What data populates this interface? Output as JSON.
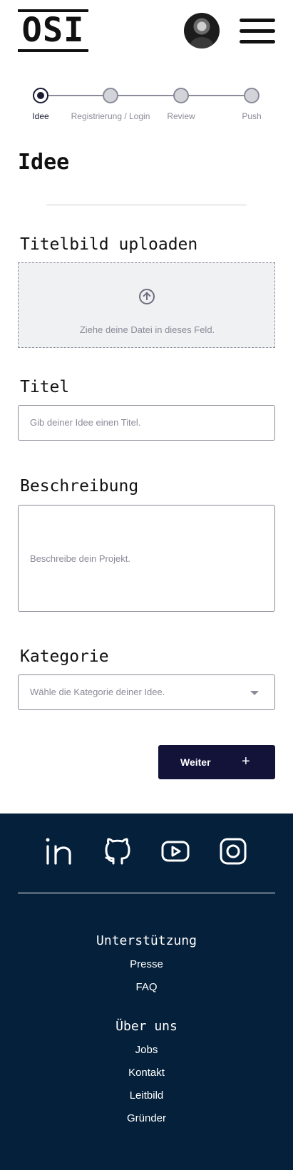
{
  "header": {
    "logo_text": "OSI",
    "avatar_alt": "user avatar",
    "menu_icon": "hamburger-menu-icon"
  },
  "stepper": {
    "steps": [
      {
        "label": "Idee",
        "state": "active"
      },
      {
        "label": "Registrierung / Login",
        "state": "pending"
      },
      {
        "label": "Review",
        "state": "pending"
      },
      {
        "label": "Push",
        "state": "pending"
      }
    ]
  },
  "page": {
    "title": "Idee"
  },
  "form": {
    "upload": {
      "label": "Titelbild uploaden",
      "hint": "Ziehe deine Datei in dieses Feld.",
      "icon": "upload-arrow-icon"
    },
    "title_field": {
      "label": "Titel",
      "placeholder": "Gib deiner Idee einen Titel.",
      "value": ""
    },
    "description_field": {
      "label": "Beschreibung",
      "placeholder": "Beschreibe dein Projekt.",
      "value": ""
    },
    "category_field": {
      "label": "Kategorie",
      "placeholder": "Wähle die Kategorie deiner Idee.",
      "icon": "chevron-down-icon"
    },
    "next_button": {
      "label": "Weiter",
      "icon": "+"
    }
  },
  "footer": {
    "social": [
      {
        "name": "linkedin-icon"
      },
      {
        "name": "github-icon"
      },
      {
        "name": "youtube-icon"
      },
      {
        "name": "instagram-icon"
      }
    ],
    "sections": [
      {
        "heading": "Unterstützung",
        "links": [
          "Presse",
          "FAQ"
        ]
      },
      {
        "heading": "Über uns",
        "links": [
          "Jobs",
          "Kontakt",
          "Leitbild",
          "Gründer"
        ]
      }
    ]
  },
  "colors": {
    "primary_dark": "#13133a",
    "footer_bg": "#05203a",
    "muted": "#8a8a98"
  }
}
